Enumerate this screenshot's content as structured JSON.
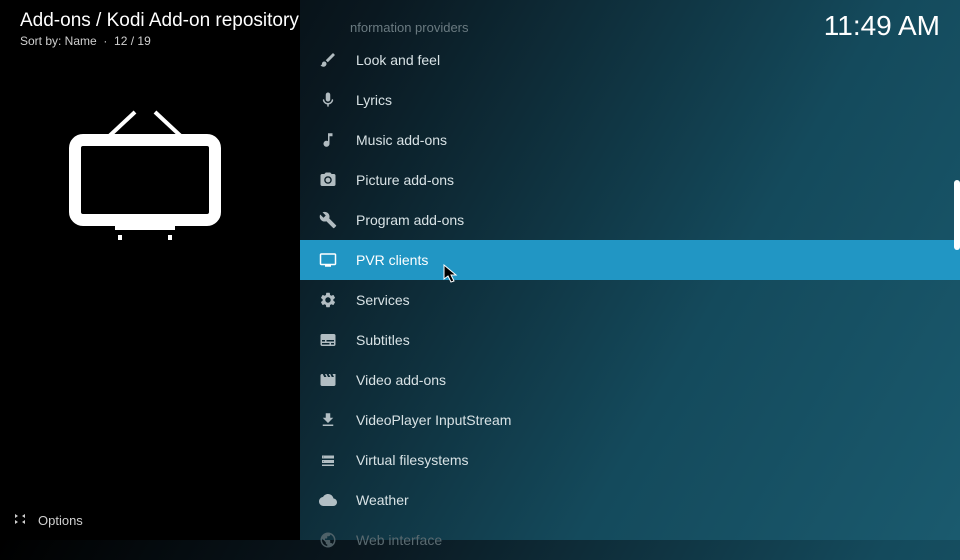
{
  "header": {
    "breadcrumb": "Add-ons / Kodi Add-on repository",
    "sort_label": "Sort by: Name",
    "counter": "12 / 19",
    "faded_prev": "nformation providers",
    "clock": "11:49 AM"
  },
  "list": {
    "items": [
      {
        "icon": "brush",
        "label": "Look and feel",
        "selected": false,
        "faded": false
      },
      {
        "icon": "mic",
        "label": "Lyrics",
        "selected": false,
        "faded": false
      },
      {
        "icon": "music",
        "label": "Music add-ons",
        "selected": false,
        "faded": false
      },
      {
        "icon": "camera",
        "label": "Picture add-ons",
        "selected": false,
        "faded": false
      },
      {
        "icon": "tools",
        "label": "Program add-ons",
        "selected": false,
        "faded": false
      },
      {
        "icon": "tv",
        "label": "PVR clients",
        "selected": true,
        "faded": false
      },
      {
        "icon": "gear",
        "label": "Services",
        "selected": false,
        "faded": false
      },
      {
        "icon": "subtitles",
        "label": "Subtitles",
        "selected": false,
        "faded": false
      },
      {
        "icon": "film",
        "label": "Video add-ons",
        "selected": false,
        "faded": false
      },
      {
        "icon": "download",
        "label": "VideoPlayer InputStream",
        "selected": false,
        "faded": false
      },
      {
        "icon": "hdd",
        "label": "Virtual filesystems",
        "selected": false,
        "faded": false
      },
      {
        "icon": "weather",
        "label": "Weather",
        "selected": false,
        "faded": false
      },
      {
        "icon": "globe",
        "label": "Web interface",
        "selected": false,
        "faded": true
      }
    ]
  },
  "footer": {
    "options_label": "Options"
  },
  "colors": {
    "selected_bg": "#2196c4"
  }
}
